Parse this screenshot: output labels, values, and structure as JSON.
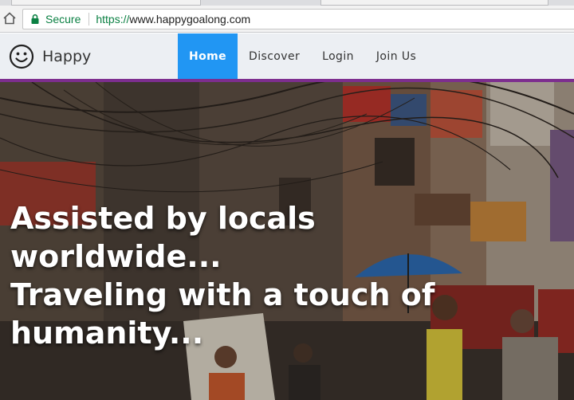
{
  "browser": {
    "security_label": "Secure",
    "url_scheme": "https://",
    "url_host": "www.happygoalong.com"
  },
  "site": {
    "brand_name": "Happy",
    "nav": {
      "home": "Home",
      "discover": "Discover",
      "login": "Login",
      "join": "Join Us"
    }
  },
  "hero": {
    "headline_line1": "Assisted by locals",
    "headline_line2": "worldwide...",
    "headline_line3": "Traveling with a touch of",
    "headline_line4": "humanity..."
  },
  "colors": {
    "nav_active": "#2196f3",
    "nav_accent": "#7d2e8f",
    "secure_green": "#0b8043"
  },
  "icons": {
    "home": "home-icon",
    "lock": "lock-icon",
    "brand": "smiley-icon"
  }
}
